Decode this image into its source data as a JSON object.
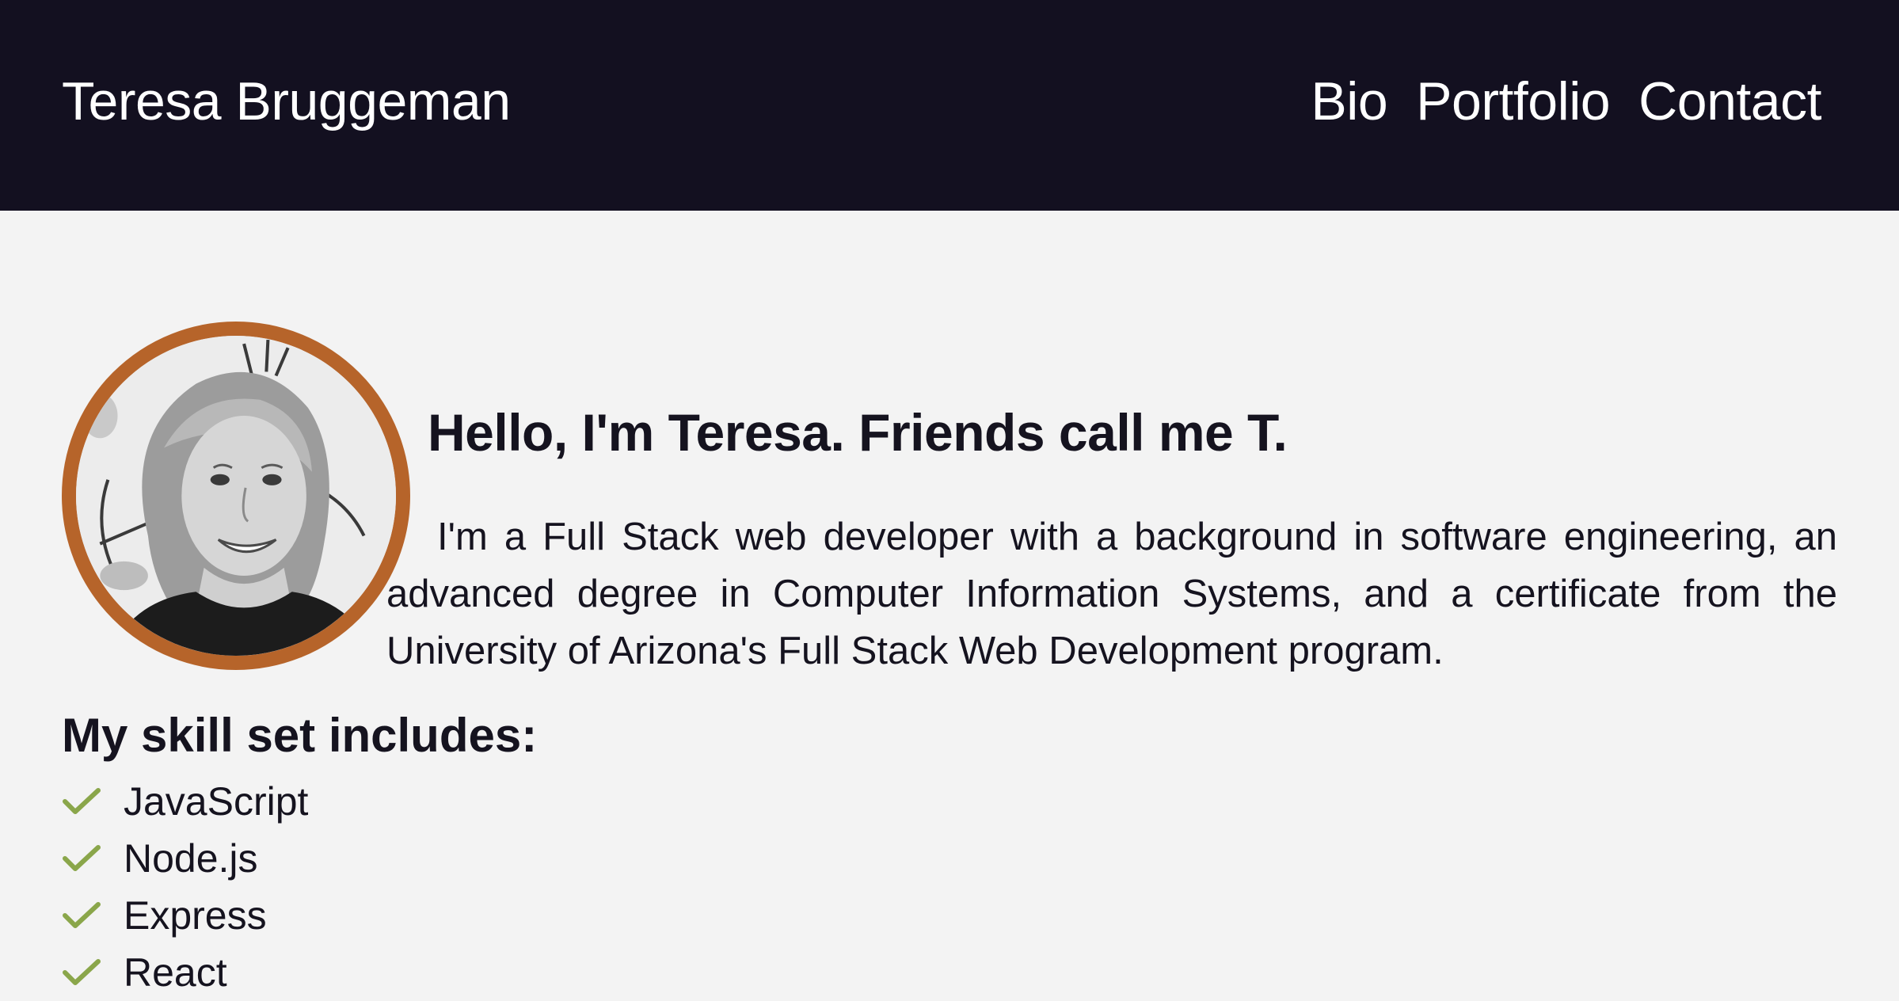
{
  "header": {
    "site_name": "Teresa Bruggeman",
    "nav": [
      "Bio",
      "Portfolio",
      "Contact"
    ]
  },
  "intro": {
    "greeting": "Hello, I'm Teresa. Friends call me T.",
    "bio": "I'm a Full Stack web developer with a background in software engineering, an advanced degree in Computer Information Systems, and a certificate from the University of Arizona's Full Stack Web Development program."
  },
  "skills": {
    "heading": "My skill set includes:",
    "items": [
      "JavaScript",
      "Node.js",
      "Express",
      "React"
    ],
    "icon": "check-icon"
  },
  "colors": {
    "header_bg": "#131020",
    "page_bg": "#f3f3f3",
    "avatar_border": "#b6642a",
    "check": "#8aa64a"
  }
}
